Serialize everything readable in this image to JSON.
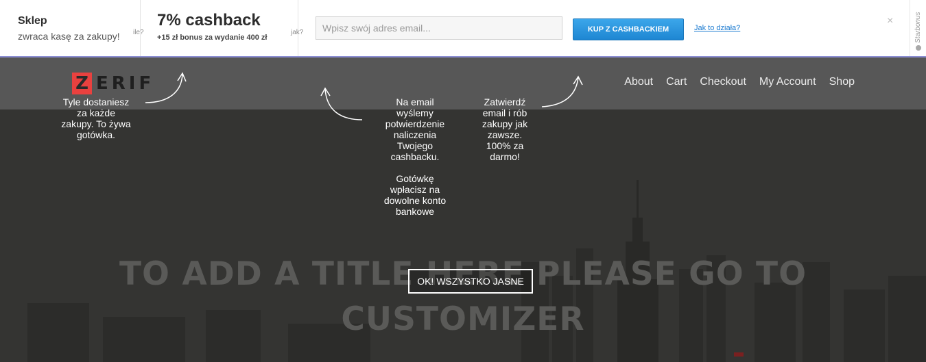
{
  "topbar": {
    "shop_title": "Sklep",
    "shop_subtitle": "zwraca kasę za zakupy!",
    "q_how_much": "ile?",
    "cashback_title": "7% cashback",
    "cashback_bonus": "+15 zł bonus za wydanie 400 zł",
    "q_how": "jak?",
    "email_placeholder": "Wpisz swój adres email...",
    "email_value": "",
    "cta_label": "KUP Z CASHBACKIEM",
    "how_link": "Jak to działa?",
    "close_glyph": "×",
    "brand_vertical": "Starbonus",
    "accent_color": "#1e86d2"
  },
  "site": {
    "logo_first": "Z",
    "logo_rest": "ERIF",
    "menu": [
      {
        "label": "About"
      },
      {
        "label": "Cart"
      },
      {
        "label": "Checkout"
      },
      {
        "label": "My Account"
      },
      {
        "label": "Shop"
      }
    ],
    "hero_title_line1": "TO ADD A TITLE HERE PLEASE GO TO",
    "hero_title_line2": "CUSTOMIZER"
  },
  "overlay": {
    "tip1": "Tyle dostaniesz za każde zakupy. To żywa gotówka.",
    "tip2a": "Na email wyślemy potwierdzenie naliczenia Twojego cashbacku.",
    "tip2b": "Gotówkę wpłacisz na dowolne konto bankowe",
    "tip3": "Zatwierdź email i rób zakupy jak zawsze. 100% za darmo!",
    "ok_label": "OK! WSZYSTKO JASNE"
  }
}
